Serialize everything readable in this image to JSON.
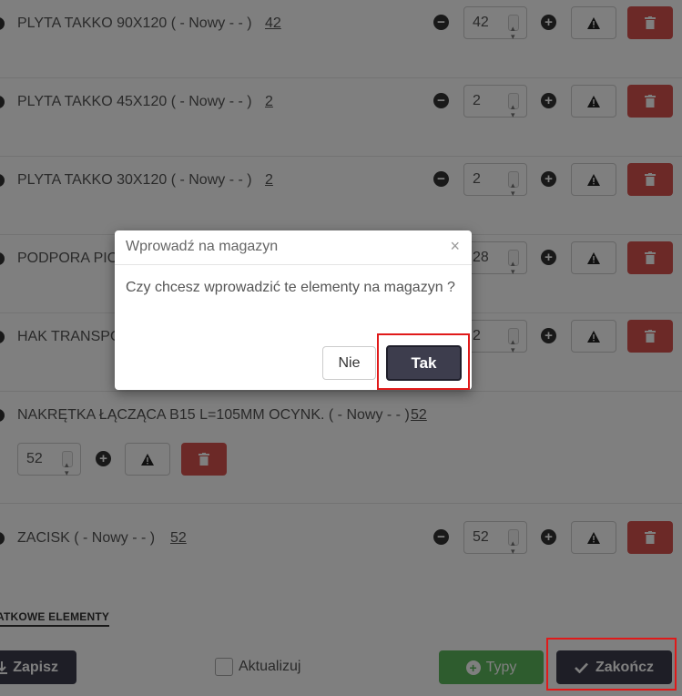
{
  "items": [
    {
      "name": "PLYTA TAKKO 90X120 ( - Nowy - - )",
      "qty_link": "42",
      "input_value": "42"
    },
    {
      "name": "PLYTA TAKKO 45X120 ( - Nowy - - )",
      "qty_link": "2",
      "input_value": "2"
    },
    {
      "name": "PLYTA TAKKO 30X120 ( - Nowy - - )",
      "qty_link": "2",
      "input_value": "2"
    },
    {
      "name": "PODPORA PIO",
      "qty_link": "",
      "input_value": "28"
    },
    {
      "name": "HAK TRANSPO",
      "qty_link": "",
      "input_value": "2"
    },
    {
      "name": "NAKRĘTKA ŁĄCZĄCA B15 L=105MM OCYNK. ( - Nowy - - )",
      "qty_link": "52",
      "input_value": "52"
    },
    {
      "name": "ZACISK ( - Nowy - - )",
      "qty_link": "52",
      "input_value": "52"
    }
  ],
  "icons": {
    "minus": "minus-circle-icon",
    "plus": "plus-circle-icon",
    "warning": "warning-triangle-icon",
    "trash": "trash-icon"
  },
  "section_title": "ATKOWE ELEMENTY",
  "footer": {
    "save_label": "Zapisz",
    "update_label": "Aktualizuj",
    "types_label": "Typy",
    "finish_label": "Zakończ"
  },
  "modal": {
    "title": "Wprowadź na magazyn",
    "close": "×",
    "message": "Czy chcesz wprowadzić te elementy na magazyn ?",
    "no_label": "Nie",
    "yes_label": "Tak"
  },
  "colors": {
    "primary_dark": "#3d3d4d",
    "danger": "#d9534f",
    "success": "#5cb85c",
    "highlight": "#e01a1a"
  }
}
